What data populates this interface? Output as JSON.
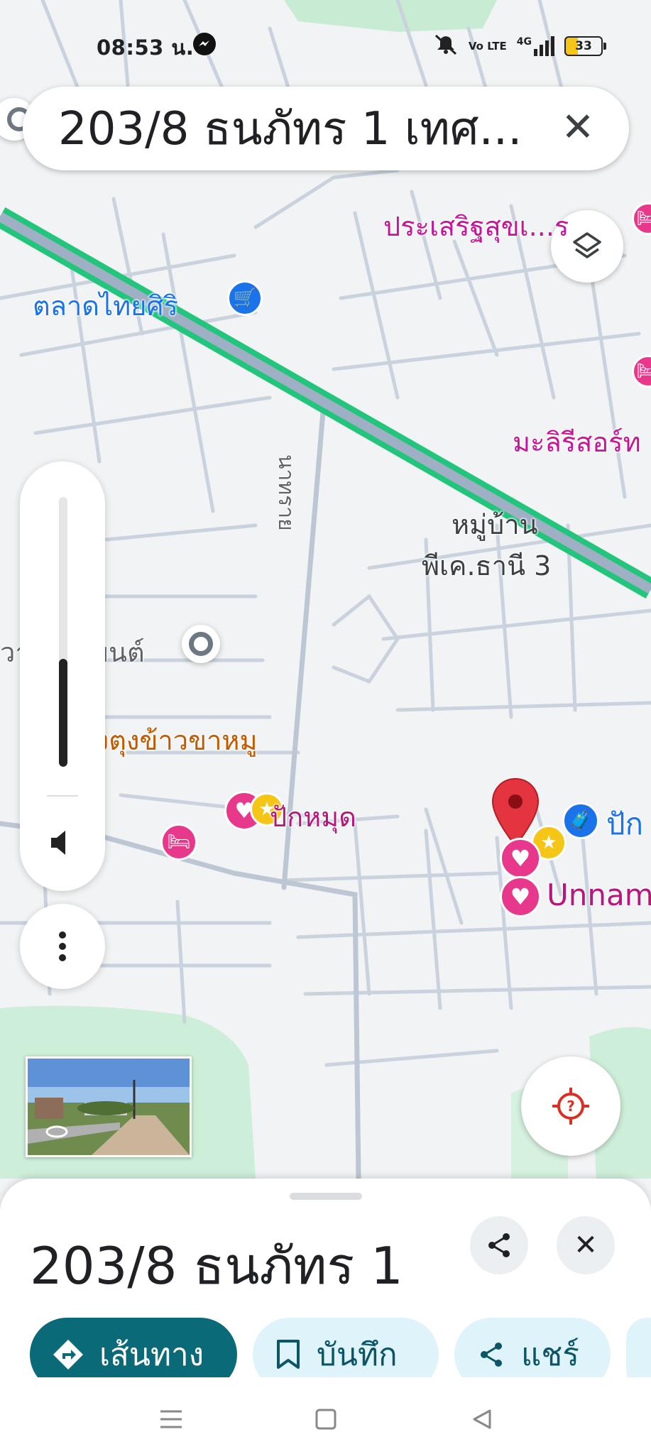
{
  "status_bar": {
    "time": "08:53 น.",
    "network": "Vo LTE",
    "signal": "4G",
    "battery": "33"
  },
  "search": {
    "query": "203/8 ธนภัทร 1 เทศ..."
  },
  "map": {
    "labels": {
      "market": "ตลาดไทยศิริ",
      "prasert": "ประเสริฐสุขเ...ร",
      "malirisort": "มะลิรีสอร์ท",
      "village_line1": "หมู่บ้าน",
      "village_line2": "พีเค.ธานี 3",
      "road": "นาทราย",
      "car_shop": "วาเจริญยนต์",
      "restaurant": "ตุงตุงข้าวขาหมู",
      "pakmud": "ปักหมุด",
      "pak_right": "ปัก",
      "unnamed": "Unnam"
    }
  },
  "volume": {
    "level": 0.4
  },
  "place": {
    "title": "203/8 ธนภัทร 1"
  },
  "actions": {
    "directions": "เส้นทาง",
    "save": "บันทึก",
    "share": "แชร์"
  },
  "colors": {
    "route": "#2bd48c",
    "primary": "#0b6a78",
    "pin": "#e3343f",
    "poi_pink": "#e8388c"
  }
}
